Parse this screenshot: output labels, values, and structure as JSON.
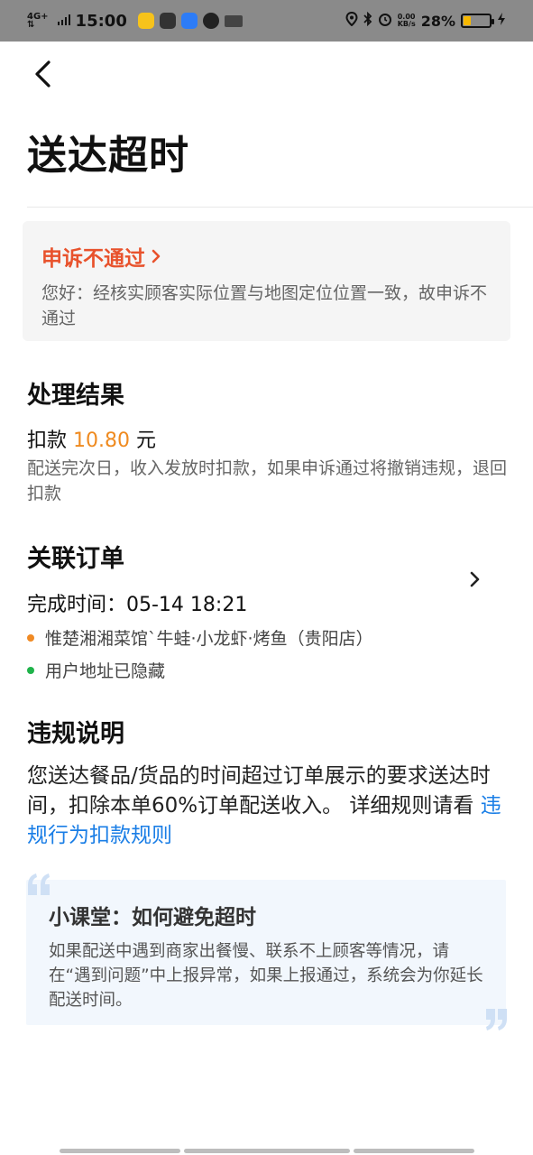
{
  "status_bar": {
    "network_top": "4G+",
    "network_bottom": "⇅",
    "time": "15:00",
    "speed_top": "0.00",
    "speed_bottom": "KB/s",
    "battery": "28%",
    "battery_level": 0.28,
    "battery_color": "#f6b800"
  },
  "header": {
    "back_icon": "chevron-left-icon",
    "title": "送达超时"
  },
  "appeal": {
    "status": "申诉不通过",
    "status_color": "#e8522c",
    "message": "您好：经核实顾客实际位置与地图定位位置一致，故申诉不通过"
  },
  "result": {
    "title": "处理结果",
    "deduction_prefix": "扣款",
    "deduction_amount": "10.80",
    "deduction_unit": "元",
    "amount_color": "#ef8a1f",
    "note": "配送完次日，收入发放时扣款，如果申诉通过将撤销违规，退回扣款"
  },
  "order": {
    "title": "关联订单",
    "finish_time": "完成时间：05-14 18:21",
    "store": "惟楚湘湘菜馆`牛蛙·小龙虾·烤鱼（贵阳店）",
    "store_dot_color": "#f08a24",
    "address": "用户地址已隐藏",
    "address_dot_color": "#1fb34a"
  },
  "violation": {
    "title": "违规说明",
    "text": "您送达餐品/货品的时间超过订单展示的要求送达时间，扣除本单60%订单配送收入。 详细规则请看 ",
    "link_text": "违规行为扣款规则",
    "link_color": "#1a7ee6"
  },
  "tips": {
    "title": "小课堂：如何避免超时",
    "body": "如果配送中遇到商家出餐慢、联系不上顾客等情况，请在“遇到问题”中上报异常，如果上报通过，系统会为你延长配送时间。"
  }
}
